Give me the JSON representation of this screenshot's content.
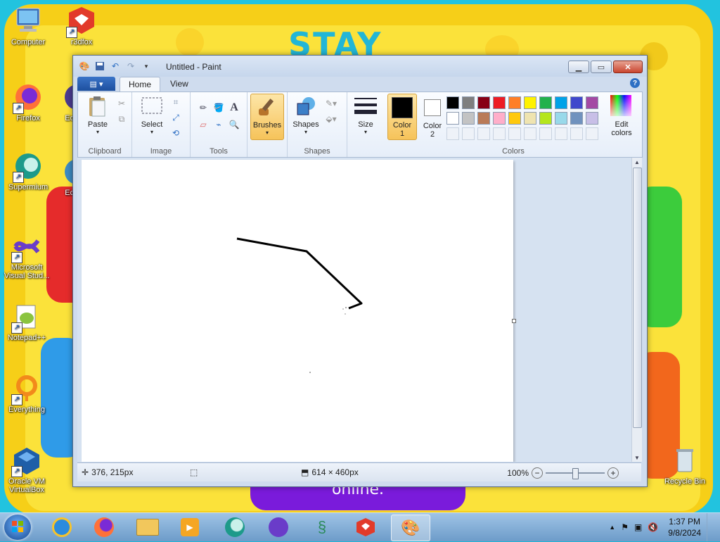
{
  "desktop": {
    "icons": [
      {
        "label": "Computer",
        "name": "computer"
      },
      {
        "label": "r3dfox",
        "name": "r3dfox"
      },
      {
        "label": "Firefox",
        "name": "firefox"
      },
      {
        "label": "Ecli",
        "name": "eclipse-1"
      },
      {
        "label": "Supermium",
        "name": "supermium"
      },
      {
        "label": "Ecli",
        "name": "eclipse-2"
      },
      {
        "label": "Microsoft Visual Stud...",
        "name": "visual-studio"
      },
      {
        "label": "Notepad++",
        "name": "notepadpp"
      },
      {
        "label": "Everything",
        "name": "everything"
      },
      {
        "label": "Oracle VM VirtualBox",
        "name": "virtualbox"
      },
      {
        "label": "Recycle Bin",
        "name": "recycle-bin"
      }
    ],
    "wallpaper": {
      "top_text": "STAY",
      "bottom_text": "online."
    }
  },
  "paint": {
    "title": "Untitled - Paint",
    "tabs": {
      "file": "▤ ▾",
      "home": "Home",
      "view": "View"
    },
    "clipboard": {
      "label": "Clipboard",
      "paste": "Paste"
    },
    "image": {
      "label": "Image",
      "select": "Select"
    },
    "tools": {
      "label": "Tools"
    },
    "brushes": {
      "label": "Brushes"
    },
    "shapes": {
      "label": "Shapes",
      "shapes_btn": "Shapes"
    },
    "size": {
      "label": "Size"
    },
    "colors": {
      "label": "Colors",
      "color1": "Color 1",
      "color1_line1": "Color",
      "color1_line2": "1",
      "color2_line1": "Color",
      "color2_line2": "2",
      "edit_line1": "Edit",
      "edit_line2": "colors",
      "color1_value": "#000000",
      "color2_value": "#ffffff",
      "palette_row1": [
        "#000000",
        "#7f7f7f",
        "#880015",
        "#ed1c24",
        "#ff7f27",
        "#fff200",
        "#22b14c",
        "#00a2e8",
        "#3f48cc",
        "#a349a4"
      ],
      "palette_row2": [
        "#ffffff",
        "#c3c3c3",
        "#b97a57",
        "#ffaec9",
        "#ffc90e",
        "#efe4b0",
        "#b5e61d",
        "#99d9ea",
        "#7092be",
        "#c8bfe7"
      ]
    },
    "status": {
      "cursor_pos": "376, 215px",
      "canvas_size": "614 × 460px",
      "zoom": "100%"
    }
  },
  "taskbar": {
    "time": "1:37 PM",
    "date": "9/8/2024"
  }
}
